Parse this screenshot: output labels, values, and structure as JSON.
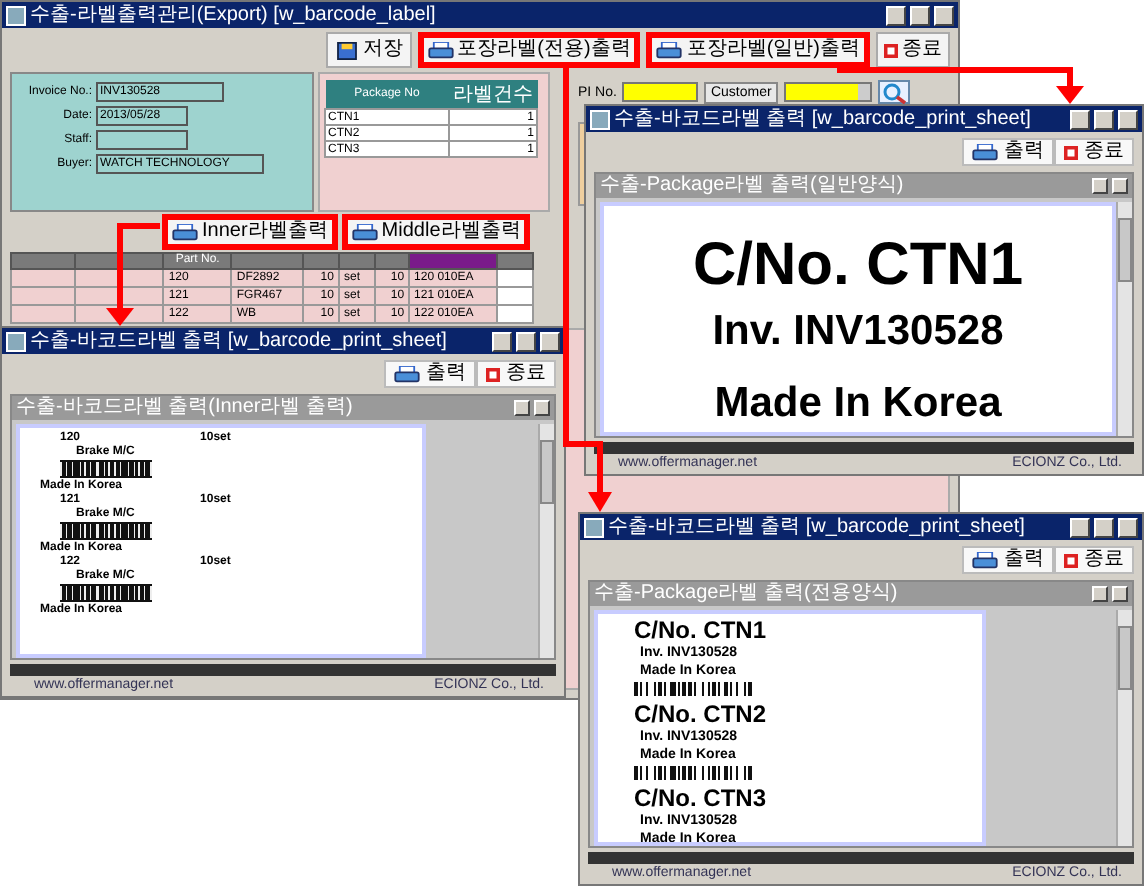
{
  "main_window": {
    "title": "수출-라벨출력관리(Export) [w_barcode_label]",
    "toolbar": [
      {
        "kind": "save",
        "label": "저장",
        "highlighted": false
      },
      {
        "kind": "print",
        "label": "포장라벨(전용)출력",
        "highlighted": true
      },
      {
        "kind": "print",
        "label": "포장라벨(일반)출력",
        "highlighted": true
      },
      {
        "kind": "close",
        "label": "종료",
        "highlighted": false
      }
    ],
    "form": [
      {
        "label": "Invoice No.:",
        "value": "INV130528"
      },
      {
        "label": "Date:",
        "value": "2013/05/28"
      },
      {
        "label": "Staff:"
      },
      {
        "label": "Buyer:",
        "value": "WATCH TECHNOLOGY"
      }
    ],
    "package_table": {
      "columns": [
        "Package No",
        "라벨건수"
      ],
      "rows": [
        [
          "CTN1",
          "1"
        ],
        [
          "CTN2",
          "1"
        ],
        [
          "CTN3",
          "1"
        ]
      ]
    },
    "search": {
      "fields": [
        {
          "kind": "input",
          "label": "PI No."
        },
        {
          "kind": "dropdown",
          "label": "Customer"
        }
      ]
    },
    "label_buttons": [
      {
        "label": "Inner라벨출력",
        "highlighted": true
      },
      {
        "label": "Middle라벨출력",
        "highlighted": true
      }
    ],
    "grid": {
      "header": "Part No.",
      "rows": [
        {
          "part_no": "120",
          "column_4": "DF2892",
          "qty": "10",
          "unit": "set",
          "column_7": "10",
          "column_8": "120 010EA"
        },
        {
          "part_no": "121",
          "column_4": "FGR467",
          "qty": "10",
          "unit": "set",
          "column_7": "10",
          "column_8": "121 010EA"
        },
        {
          "part_no": "122",
          "column_4": "WB",
          "qty": "10",
          "unit": "set",
          "column_7": "10",
          "column_8": "122 010EA"
        }
      ]
    }
  },
  "print_windows": [
    {
      "kind": "inner",
      "title": "수출-바코드라벨 출력 [w_barcode_print_sheet]",
      "buttons": [
        {
          "kind": "print",
          "label": "출력"
        },
        {
          "kind": "close",
          "label": "종료"
        }
      ],
      "document_title": "수출-바코드라벨 출력(Inner라벨 출력)",
      "labels": [
        {
          "number": "120",
          "quantity": "10set",
          "name": "Brake M/C",
          "origin": "Made In Korea"
        },
        {
          "number": "121",
          "quantity": "10set",
          "name": "Brake M/C",
          "origin": "Made In Korea"
        },
        {
          "number": "122",
          "quantity": "10set",
          "name": "Brake M/C",
          "origin": "Made In Korea"
        }
      ],
      "website": "www.offermanager.net",
      "company": "ECIONZ Co., Ltd."
    },
    {
      "kind": "large",
      "title": "수출-바코드라벨 출력 [w_barcode_print_sheet]",
      "buttons": [
        {
          "kind": "print",
          "label": "출력"
        },
        {
          "kind": "close",
          "label": "종료"
        }
      ],
      "document_title": "수출-Package라벨 출력(일반양식)",
      "labels": [
        {
          "carton": "C/No. CTN1",
          "invoice": "Inv. INV130528",
          "origin": "Made In Korea"
        }
      ],
      "website": "www.offermanager.net",
      "company": "ECIONZ Co., Ltd."
    },
    {
      "kind": "list",
      "title": "수출-바코드라벨 출력 [w_barcode_print_sheet]",
      "buttons": [
        {
          "kind": "print",
          "label": "출력"
        },
        {
          "kind": "close",
          "label": "종료"
        }
      ],
      "document_title": "수출-Package라벨 출력(전용양식)",
      "labels": [
        {
          "carton": "C/No. CTN1",
          "invoice": "Inv. INV130528",
          "origin": "Made In Korea"
        },
        {
          "carton": "C/No. CTN2",
          "invoice": "Inv. INV130528",
          "origin": "Made In Korea"
        },
        {
          "carton": "C/No. CTN3",
          "invoice": "Inv. INV130528",
          "origin": "Made In Korea"
        }
      ],
      "website": "www.offermanager.net",
      "company": "ECIONZ Co., Ltd."
    }
  ]
}
